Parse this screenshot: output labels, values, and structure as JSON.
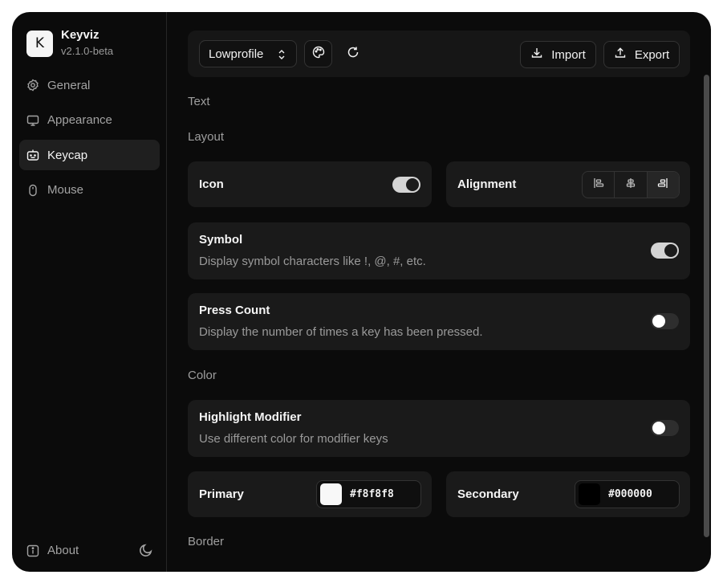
{
  "app": {
    "logo_letter": "K",
    "name": "Keyviz",
    "version": "v2.1.0-beta"
  },
  "sidebar": {
    "items": [
      {
        "label": "General",
        "icon": "gear-icon",
        "active": false
      },
      {
        "label": "Appearance",
        "icon": "monitor-icon",
        "active": false
      },
      {
        "label": "Keycap",
        "icon": "keycap-icon",
        "active": true
      },
      {
        "label": "Mouse",
        "icon": "mouse-icon",
        "active": false
      }
    ],
    "about_label": "About",
    "theme_icon": "moon-icon"
  },
  "toolbar": {
    "profile": "Lowprofile",
    "import_label": "Import",
    "export_label": "Export"
  },
  "sections": {
    "text": "Text",
    "layout": "Layout",
    "color": "Color",
    "border": "Border"
  },
  "settings": {
    "icon": {
      "title": "Icon",
      "enabled": true
    },
    "alignment": {
      "title": "Alignment",
      "options": [
        "left",
        "center",
        "right"
      ],
      "selected": "right"
    },
    "symbol": {
      "title": "Symbol",
      "description": "Display symbol characters like !, @, #, etc.",
      "enabled": true
    },
    "press_count": {
      "title": "Press Count",
      "description": "Display the number of times a key has been pressed.",
      "enabled": false
    },
    "highlight_modifier": {
      "title": "Highlight Modifier",
      "description": "Use different color for modifier keys",
      "enabled": false
    },
    "primary": {
      "title": "Primary",
      "value": "#f8f8f8"
    },
    "secondary": {
      "title": "Secondary",
      "value": "#000000"
    }
  },
  "colors": {
    "window_bg": "#0b0b0b",
    "card_bg": "#1a1a1a",
    "accent": "#d4d4d4"
  }
}
